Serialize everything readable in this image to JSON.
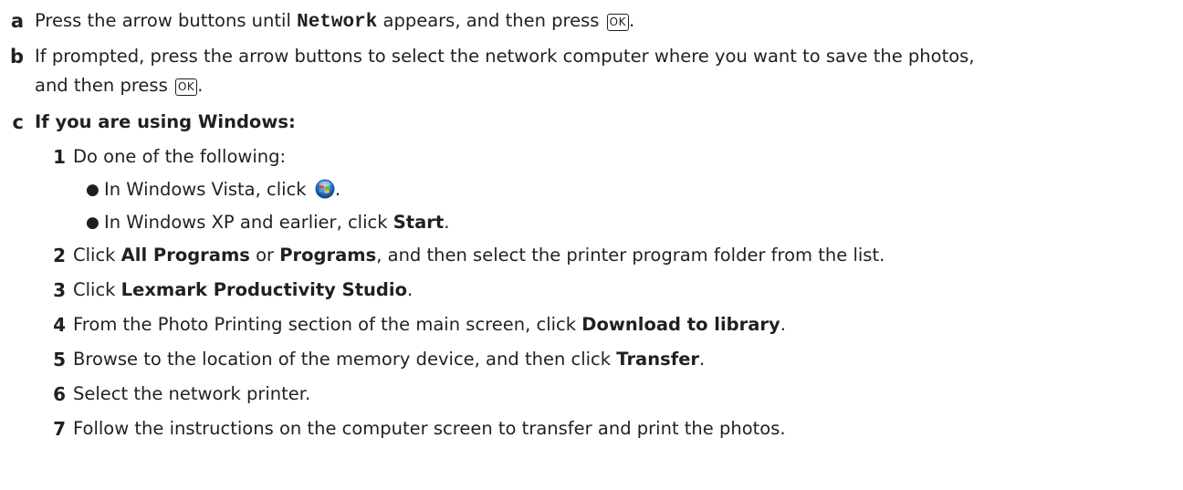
{
  "step_a": {
    "letter": "a",
    "before": "Press the arrow buttons until ",
    "code": "Network",
    "after": " appears, and then press ",
    "key": "OK",
    "end": "."
  },
  "step_b": {
    "letter": "b",
    "line1": "If prompted, press the arrow buttons to select the network computer where you want to save the photos,",
    "line2_before": "and then press ",
    "key": "OK",
    "end": "."
  },
  "step_c": {
    "letter": "c",
    "heading": "If you are using Windows:",
    "substeps": {
      "s1": {
        "num": "1",
        "text": "Do one of the following:",
        "bullet1": {
          "before": "In Windows Vista, click ",
          "icon": "windows-start-orb-icon",
          "end": "."
        },
        "bullet2": {
          "before": "In Windows XP and earlier, click ",
          "bold": "Start",
          "end": "."
        }
      },
      "s2": {
        "num": "2",
        "pre": "Click ",
        "bold1": "All Programs",
        "mid": " or ",
        "bold2": "Programs",
        "post": ", and then select the printer program folder from the list."
      },
      "s3": {
        "num": "3",
        "pre": "Click ",
        "bold": "Lexmark Productivity Studio",
        "post": "."
      },
      "s4": {
        "num": "4",
        "pre": "From the Photo Printing section of the main screen, click ",
        "bold": "Download to library",
        "post": "."
      },
      "s5": {
        "num": "5",
        "pre": "Browse to the location of the memory device, and then click ",
        "bold": "Transfer",
        "post": "."
      },
      "s6": {
        "num": "6",
        "text": "Select the network printer."
      },
      "s7": {
        "num": "7",
        "text": "Follow the instructions on the computer screen to transfer and print the photos."
      }
    }
  },
  "colors": {
    "text": "#231f20",
    "vista_orb_blue": "#2f74c8",
    "vista_flag_red": "#e8442e",
    "vista_flag_green": "#5dbb3a",
    "vista_flag_yellow": "#f6c21c",
    "vista_flag_blue": "#3aa6e8"
  }
}
